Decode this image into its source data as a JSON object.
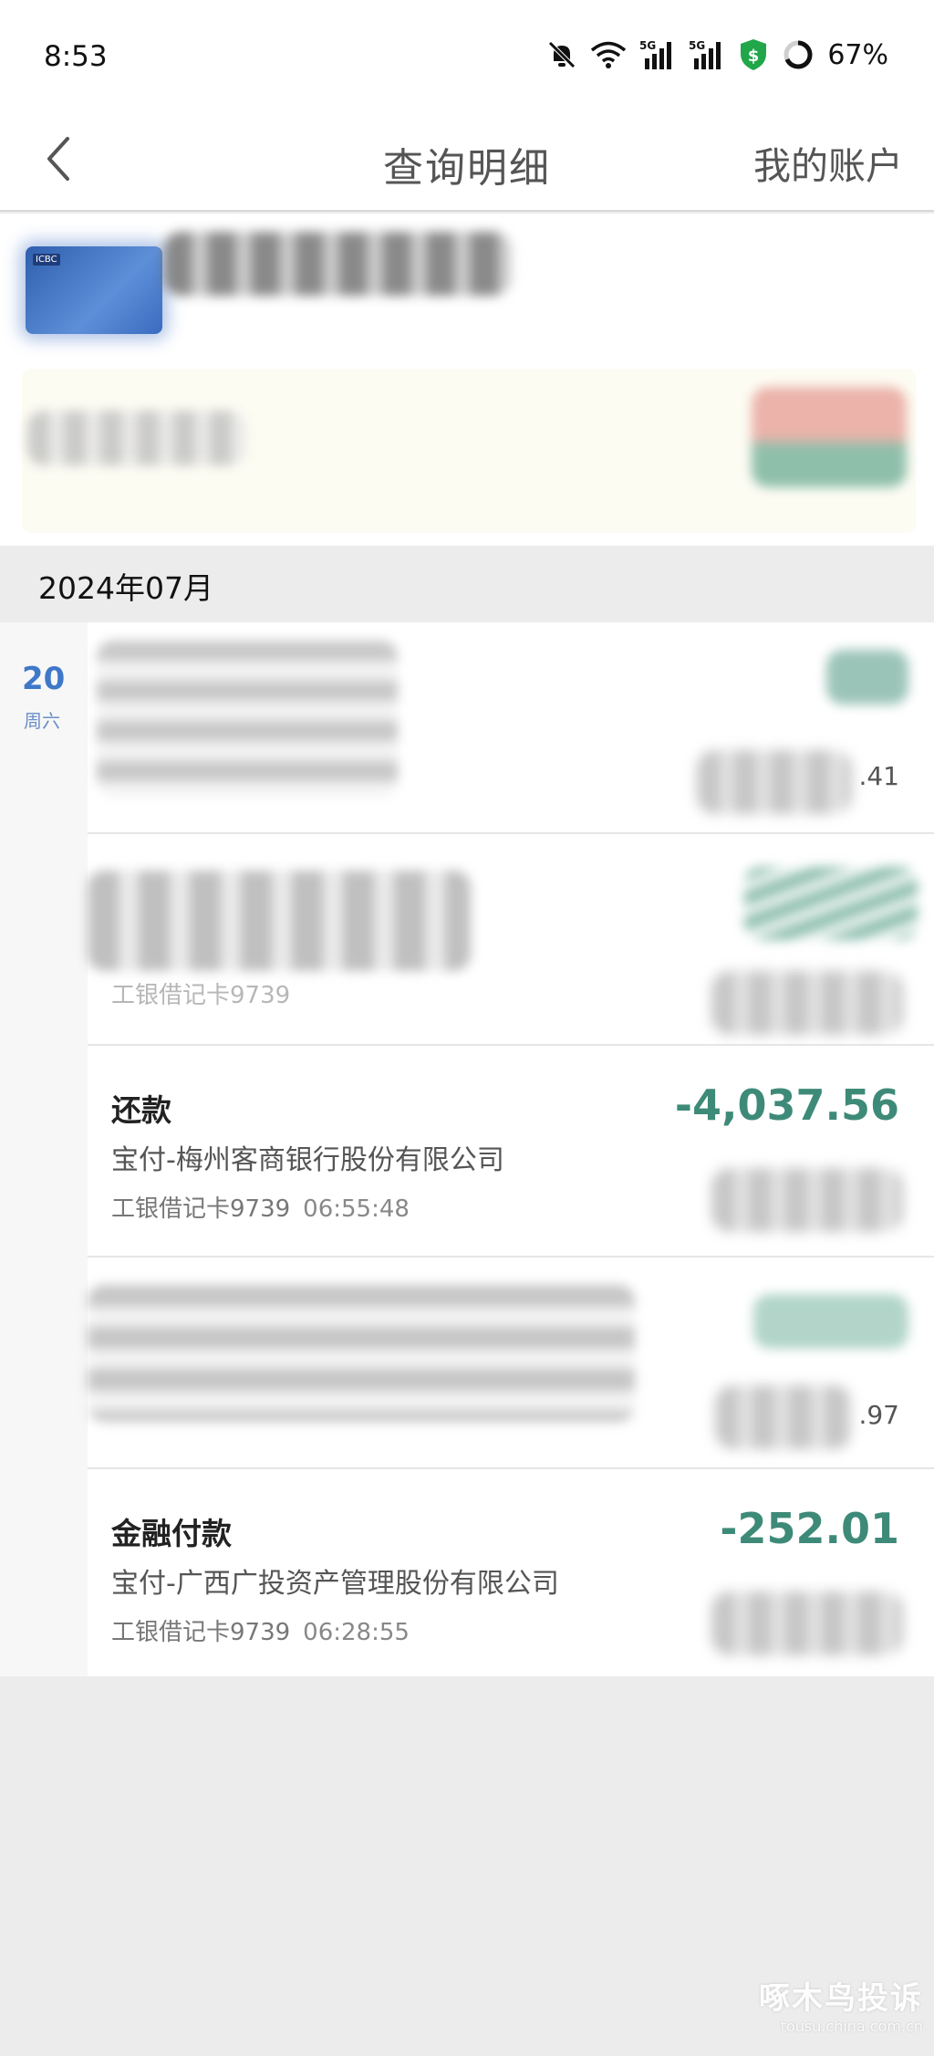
{
  "status_bar": {
    "time": "8:53",
    "battery": "67%",
    "icons": [
      "bell-off-icon",
      "wifi-icon",
      "5g-signal-icon",
      "5g-signal-icon",
      "shield-dollar-icon",
      "battery-ring-icon"
    ]
  },
  "nav": {
    "title": "查询明细",
    "right_link": "我的账户"
  },
  "card": {
    "badge": "ICBC"
  },
  "month_header": "2024年07月",
  "date_column": {
    "day": "20",
    "weekday": "周六"
  },
  "transactions": [
    {
      "title": "还款",
      "merchant": "宝付-梅州客商银行股份有限公司",
      "account": "工银借记卡9739",
      "time": "06:55:48",
      "amount": "-4,037.56"
    },
    {
      "title": "金融付款",
      "merchant": "宝付-广西广投资产管理股份有限公司",
      "account": "工银借记卡9739",
      "time": "06:28:55",
      "amount": "-252.01"
    }
  ],
  "redacted_fragments": {
    "item1_balance_tail": ".41",
    "item2_account": "工银借记卡9739",
    "item4_balance_tail": ".97"
  },
  "watermark": {
    "main": "啄木鸟投诉",
    "sub": "tousu.china.com.cn"
  },
  "colors": {
    "amount_green": "#3e8a78",
    "date_blue": "#3f78c8",
    "background_gray": "#ececec"
  }
}
